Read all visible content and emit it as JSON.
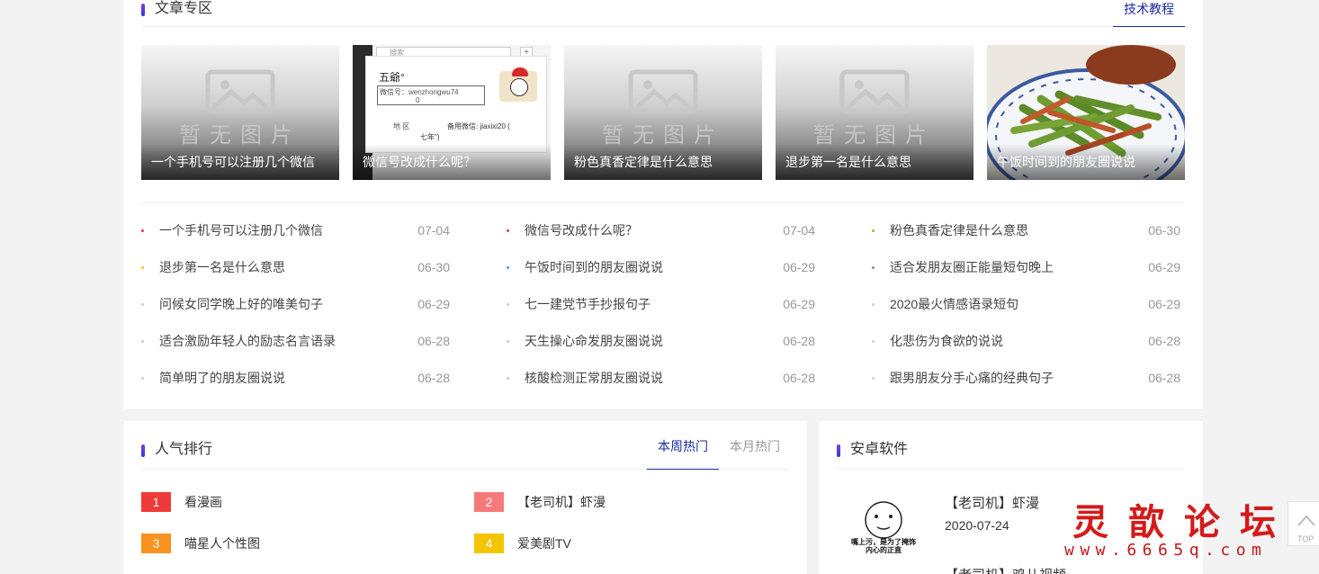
{
  "articles": {
    "title": "文章专区",
    "tab": "技术教程",
    "thumbs": [
      {
        "caption": "一个手机号可以注册几个微信",
        "kind": "placeholder"
      },
      {
        "caption": "微信号改成什么呢？",
        "kind": "wechat"
      },
      {
        "caption": "粉色真香定律是什么意思",
        "kind": "placeholder"
      },
      {
        "caption": "退步第一名是什么意思",
        "kind": "placeholder"
      },
      {
        "caption": "午饭时间到的朋友圈说说",
        "kind": "food"
      }
    ],
    "placeholder_text": "暂无图片",
    "wechat_shot": {
      "search": "搜索",
      "name": "五爺°",
      "id_label": "微信号：wenzhongwu74",
      "id_cont": "0",
      "region": "地  区",
      "backup": "备用微信:  jiaxixi20  (",
      "backup2": "七年\")"
    },
    "columns": [
      [
        {
          "title": "一个手机号可以注册几个微信",
          "date": "07-04",
          "dot": "#e53935"
        },
        {
          "title": "退步第一名是什么意思",
          "date": "06-30",
          "dot": "#f5c400"
        },
        {
          "title": "问候女同学晚上好的唯美句子",
          "date": "06-29",
          "dot": "#ccc"
        },
        {
          "title": "适合激励年轻人的励志名言语录",
          "date": "06-28",
          "dot": "#ccc"
        },
        {
          "title": "简单明了的朋友圈说说",
          "date": "06-28",
          "dot": "#ccc"
        }
      ],
      [
        {
          "title": "微信号改成什么呢？",
          "date": "07-04",
          "dot": "#e53935"
        },
        {
          "title": "午饭时间到的朋友圈说说",
          "date": "06-29",
          "dot": "#5b9bd5"
        },
        {
          "title": "七一建党节手抄报句子",
          "date": "06-29",
          "dot": "#ccc"
        },
        {
          "title": "天生操心命发朋友圈说说",
          "date": "06-28",
          "dot": "#ccc"
        },
        {
          "title": "核酸检测正常朋友圈说说",
          "date": "06-28",
          "dot": "#ccc"
        }
      ],
      [
        {
          "title": "粉色真香定律是什么意思",
          "date": "06-30",
          "dot": "#f7931e"
        },
        {
          "title": "适合发朋友圈正能量短句晚上",
          "date": "06-29",
          "dot": "#888"
        },
        {
          "title": "2020最火情感语录短句",
          "date": "06-29",
          "dot": "#ccc"
        },
        {
          "title": "化悲伤为食欲的说说",
          "date": "06-28",
          "dot": "#ccc"
        },
        {
          "title": "跟男朋友分手心痛的经典句子",
          "date": "06-28",
          "dot": "#ccc"
        }
      ]
    ]
  },
  "rank": {
    "title": "人气排行",
    "tab_week": "本周热门",
    "tab_month": "本月热门",
    "items": [
      {
        "num": "1",
        "name": "看漫画",
        "color": "#f03a3a"
      },
      {
        "num": "2",
        "name": "【老司机】虾漫",
        "color": "#f77a7a"
      },
      {
        "num": "3",
        "name": "喵星人个性图",
        "color": "#f7931e"
      },
      {
        "num": "4",
        "name": "爱美剧TV",
        "color": "#f5c400"
      }
    ]
  },
  "android": {
    "title": "安卓软件",
    "app_name": "【老司机】虾漫",
    "app_date": "2020-07-24",
    "app_name2": "【老司机】鸡儿视频",
    "meme_line1": "嘴上污，是为了掩饰",
    "meme_line2": "内心的正直"
  },
  "watermark": {
    "cn": "灵歆论坛",
    "url": "www.6665q.com"
  },
  "totop": "TOP"
}
